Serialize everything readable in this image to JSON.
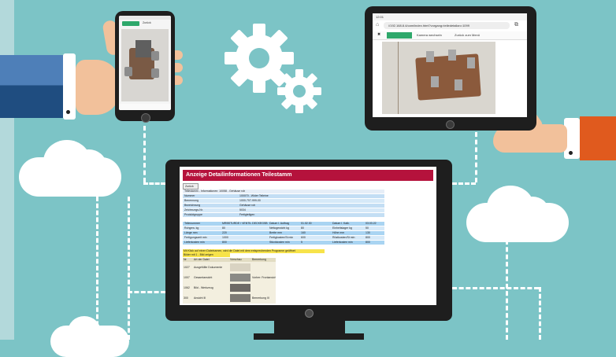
{
  "tablet": {
    "status_time": "12:01",
    "url": "//192.168.8.4/cam/index.html?vorgang=teiledetailan=1099",
    "btn_capture": "Aufnahme",
    "btn_switch": "Kamera wechseln",
    "btn_back": "Zurück zum Menü"
  },
  "phone": {
    "btn_capture": "Aufnahme",
    "btn_back": "Zurück"
  },
  "monitor": {
    "header_title": "Anzeige Detailinformationen Teilestamm",
    "back_button": "Zurück",
    "info_line": "Teilestamm - Informationen: 10058 - Gehäuse roh",
    "main_fields": [
      {
        "label": "Nummer",
        "value": "100070 - Wider Teileine"
      },
      {
        "label": "Benennung",
        "value": "1000-707-999-00"
      },
      {
        "label": "Bezeichnung",
        "value": "Gehäuse roh"
      },
      {
        "label": "Zeichnungs-Nr.",
        "value": "5034"
      },
      {
        "label": "Produktgruppe",
        "value": "Fertigteilgen"
      }
    ],
    "detail_rows": [
      [
        "Teilenummer",
        "MRBSTURDE / VENTIL DECKEGSB",
        "Datum l. Auftrag",
        "01.02.30",
        "Datum l. Kalk.",
        "03.03.22"
      ],
      [
        "Rohgew. kg",
        "80",
        "Nettogewicht kg",
        "80",
        "Einheitslager kg",
        "50"
      ],
      [
        "Länge mm",
        "220",
        "Breite mm",
        "160",
        "Höhe mm",
        "130"
      ],
      [
        "Fertigungszeit min",
        "1000",
        "Fertigkosten/St min",
        "600",
        "Rüstkosten/St min",
        "800"
      ],
      [
        "Lieferkosten min",
        "800",
        "Stückkosten min",
        "5",
        "Lieferkosten min",
        "800"
      ]
    ],
    "notice_line": "Mit Klick auf einen Dateinamen, wird die Datei mit dem entsprechenden Programm geöffnet",
    "notice_line2": "Bilder mit 1 - Bild zeigen",
    "doc_headers": [
      "Nr.",
      "Art der Datei",
      "Vorschau",
      "Bemerkung"
    ],
    "doc_rows": [
      {
        "nr": "1027",
        "type": "Ausgefüllte Dokumente",
        "note": ""
      },
      {
        "nr": "1007",
        "type": "Gesamtansicht",
        "note": "Vorher: Frontansicht"
      },
      {
        "nr": "1062",
        "type": "Bild - Werkzeug",
        "note": ""
      },
      {
        "nr": "300",
        "type": "Ansicht III",
        "note": "Bemerkung III"
      }
    ]
  },
  "colors": {
    "background": "#7cc4c6",
    "header_red": "#b5123c",
    "table_blue": "#a9d4f2",
    "accent_green": "#2ea86b"
  }
}
